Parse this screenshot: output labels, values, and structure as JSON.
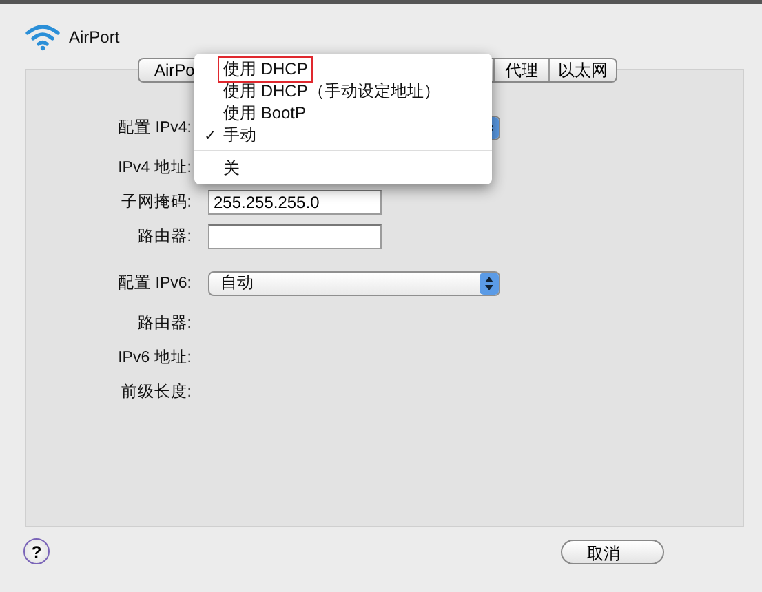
{
  "header": {
    "title": "AirPort"
  },
  "tabs": [
    {
      "label": "AirPo",
      "selected": false
    },
    {
      "label": "代理",
      "selected": false
    },
    {
      "label": "以太网",
      "selected": false
    }
  ],
  "ipv4_rows": [
    {
      "kind": "popup",
      "label": "配置 IPv4:"
    },
    {
      "kind": "static",
      "label": "IPv4 地址:"
    },
    {
      "kind": "field",
      "label": "子网掩码:",
      "value": "255.255.255.0"
    },
    {
      "kind": "field",
      "label": "路由器:"
    }
  ],
  "ipv6_rows": [
    {
      "kind": "popup",
      "label": "配置 IPv6:",
      "value": "自动"
    },
    {
      "kind": "static",
      "label": "路由器:"
    },
    {
      "kind": "static",
      "label": "IPv6 地址:"
    },
    {
      "kind": "static",
      "label": "前级长度:"
    }
  ],
  "menu": {
    "sections": [
      [
        {
          "label": "使用 DHCP",
          "checked": false,
          "highlighted": true
        },
        {
          "label": "使用 DHCP（手动设定地址）",
          "checked": false,
          "highlighted": false
        },
        {
          "label": "使用 BootP",
          "checked": false,
          "highlighted": false
        },
        {
          "label": "手动",
          "checked": true,
          "highlighted": false
        }
      ],
      [
        {
          "label": "关",
          "checked": false,
          "highlighted": false
        }
      ]
    ]
  },
  "check_mark": "✓",
  "help_button": "?",
  "buttons": [
    "取消"
  ]
}
